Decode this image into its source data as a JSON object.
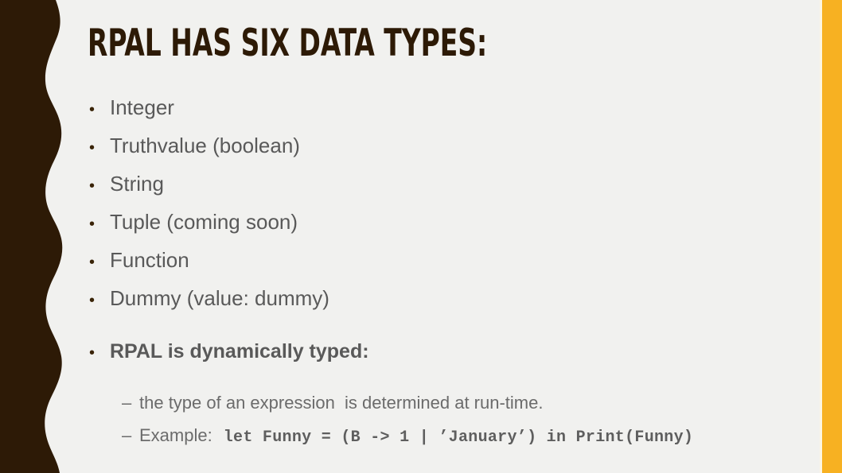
{
  "slide": {
    "title": "RPAL HAS SIX DATA TYPES:",
    "bullet_marker": "•",
    "sub_marker": "–",
    "bullets": [
      {
        "text": "Integer",
        "bold": false
      },
      {
        "text": "Truthvalue (boolean)",
        "bold": false
      },
      {
        "text": "String",
        "bold": false
      },
      {
        "text": "Tuple (coming soon)",
        "bold": false
      },
      {
        "text": "Function",
        "bold": false
      },
      {
        "text": "Dummy (value: dummy)",
        "bold": false
      },
      {
        "text": "RPAL is dynamically typed:",
        "bold": true
      }
    ],
    "sub_bullets": [
      {
        "text": "the type of an expression  is determined at run-time.",
        "code": ""
      },
      {
        "text": "Example:",
        "code": "let Funny = (B -> 1 | ’January’) in Print(Funny)"
      }
    ]
  },
  "colors": {
    "background": "#f1f1ef",
    "wave": "#2d1a06",
    "stripe": "#f7b122",
    "stripe_hairline": "#fdf6e3",
    "title_text": "#2d1a06",
    "body_text": "#595959",
    "sub_text": "#6b6b6b",
    "bullet_marker": "#3a2408",
    "code_text": "#5e5e5e"
  }
}
